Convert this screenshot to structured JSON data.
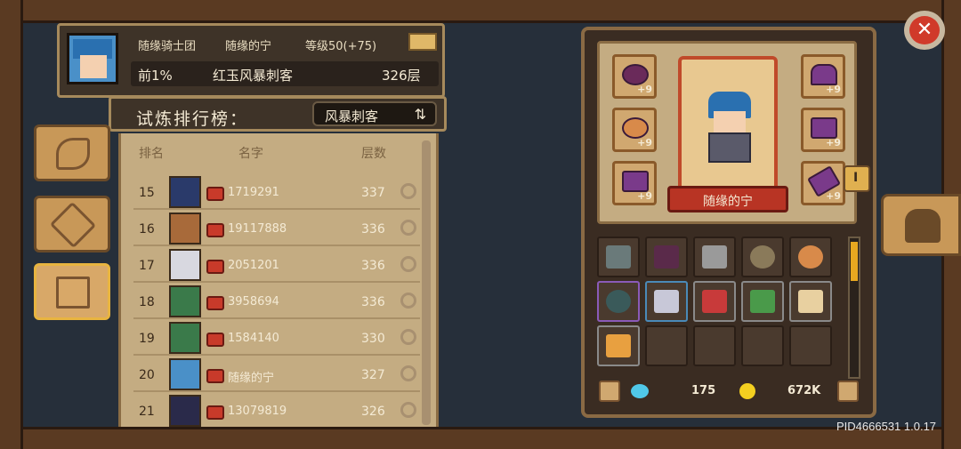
{
  "header": {
    "guild": "随缘骑士团",
    "player_name": "随缘的宁",
    "level": "等级50(+75)",
    "percentile": "前1%",
    "title": "红玉风暴刺客",
    "floor": "326层"
  },
  "ranking": {
    "title": "试炼排行榜：",
    "class_filter": "风暴刺客",
    "columns": [
      "排名",
      "名字",
      "层数"
    ],
    "rows": [
      {
        "rank": "15",
        "name": "1719291",
        "floor": "337"
      },
      {
        "rank": "16",
        "name": "19117888",
        "floor": "336"
      },
      {
        "rank": "17",
        "name": "2051201",
        "floor": "336"
      },
      {
        "rank": "18",
        "name": "3958694",
        "floor": "336"
      },
      {
        "rank": "19",
        "name": "1584140",
        "floor": "330"
      },
      {
        "rank": "20",
        "name": "随缘的宁",
        "floor": "327"
      },
      {
        "rank": "21",
        "name": "13079819",
        "floor": "326"
      }
    ]
  },
  "equipment": {
    "hero_name": "随缘的宁",
    "slot_bonus": "+9",
    "side_tab_label": "I",
    "gems": "175",
    "coins": "672K"
  },
  "footer": {
    "pid": "PID4666531 1.0.17"
  },
  "colors": {
    "panel_bg": "#3e3328",
    "list_bg": "#c4ac82",
    "accent_gold": "#a68a5c",
    "nameplate_red": "#b83424",
    "close_red": "#d03a2a"
  }
}
